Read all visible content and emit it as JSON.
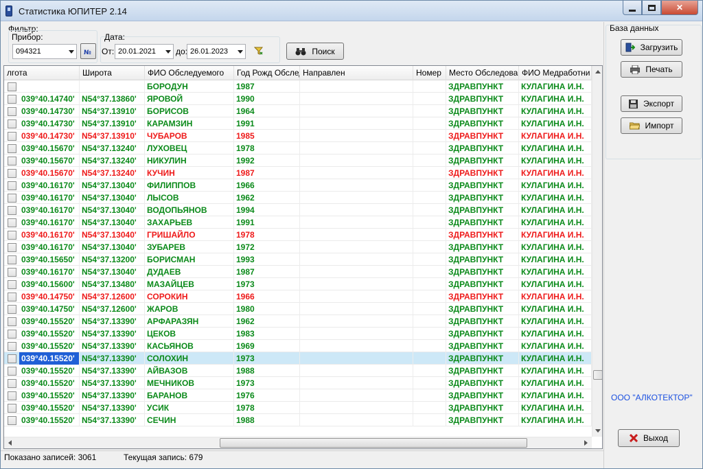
{
  "window": {
    "title": "Статистика ЮПИТЕР 2.14"
  },
  "filter": {
    "label": "Фильтр:",
    "device_label": "Прибор:",
    "device_value": "094321",
    "date_label": "Дата:",
    "from_label": "От:",
    "from_value": "20.01.2021",
    "to_label": "до:",
    "to_value": "26.01.2023",
    "search_label": "Поиск"
  },
  "right_panel": {
    "group_label": "База данных",
    "load_label": "Загрузить",
    "print_label": "Печать",
    "export_label": "Экспорт",
    "import_label": "Импорт",
    "company": "ООО \"АЛКОТЕКТОР\"",
    "exit_label": "Выход"
  },
  "grid": {
    "columns": [
      "лгота",
      "Широта",
      "ФИО Обследуемого",
      "Год Рожд Обслед",
      "Направлен",
      "Номер",
      "Место Обследова",
      "ФИО Медработни"
    ],
    "rows": [
      {
        "lon": "",
        "lat": "",
        "name": "БОРОДУН",
        "year": "1987",
        "place": "ЗДРАВПУНКТ",
        "medic": "КУЛАГИНА И.Н.",
        "color": "g"
      },
      {
        "lon": "039°40.14740'",
        "lat": "N54°37.13860'",
        "name": "ЯРОВОЙ",
        "year": "1990",
        "place": "ЗДРАВПУНКТ",
        "medic": "КУЛАГИНА И.Н.",
        "color": "g"
      },
      {
        "lon": "039°40.14730'",
        "lat": "N54°37.13910'",
        "name": "БОРИСОВ",
        "year": "1964",
        "place": "ЗДРАВПУНКТ",
        "medic": "КУЛАГИНА И.Н.",
        "color": "g"
      },
      {
        "lon": "039°40.14730'",
        "lat": "N54°37.13910'",
        "name": "КАРАМЗИН",
        "year": "1991",
        "place": "ЗДРАВПУНКТ",
        "medic": "КУЛАГИНА И.Н.",
        "color": "g"
      },
      {
        "lon": "039°40.14730'",
        "lat": "N54°37.13910'",
        "name": "ЧУБАРОВ",
        "year": "1985",
        "place": "ЗДРАВПУНКТ",
        "medic": "КУЛАГИНА И.Н.",
        "color": "r"
      },
      {
        "lon": "039°40.15670'",
        "lat": "N54°37.13240'",
        "name": "ЛУХОВЕЦ",
        "year": "1978",
        "place": "ЗДРАВПУНКТ",
        "medic": "КУЛАГИНА И.Н.",
        "color": "g"
      },
      {
        "lon": "039°40.15670'",
        "lat": "N54°37.13240'",
        "name": "НИКУЛИН",
        "year": "1992",
        "place": "ЗДРАВПУНКТ",
        "medic": "КУЛАГИНА И.Н.",
        "color": "g"
      },
      {
        "lon": "039°40.15670'",
        "lat": "N54°37.13240'",
        "name": "КУЧИН",
        "year": "1987",
        "place": "ЗДРАВПУНКТ",
        "medic": "КУЛАГИНА И.Н.",
        "color": "r"
      },
      {
        "lon": "039°40.16170'",
        "lat": "N54°37.13040'",
        "name": "ФИЛИППОВ",
        "year": "1966",
        "place": "ЗДРАВПУНКТ",
        "medic": "КУЛАГИНА И.Н.",
        "color": "g"
      },
      {
        "lon": "039°40.16170'",
        "lat": "N54°37.13040'",
        "name": "ЛЫСОВ",
        "year": "1962",
        "place": "ЗДРАВПУНКТ",
        "medic": "КУЛАГИНА И.Н.",
        "color": "g"
      },
      {
        "lon": "039°40.16170'",
        "lat": "N54°37.13040'",
        "name": "ВОДОПЬЯНОВ",
        "year": "1994",
        "place": "ЗДРАВПУНКТ",
        "medic": "КУЛАГИНА И.Н.",
        "color": "g"
      },
      {
        "lon": "039°40.16170'",
        "lat": "N54°37.13040'",
        "name": "ЗАХАРЬЕВ",
        "year": "1991",
        "place": "ЗДРАВПУНКТ",
        "medic": "КУЛАГИНА И.Н.",
        "color": "g"
      },
      {
        "lon": "039°40.16170'",
        "lat": "N54°37.13040'",
        "name": "ГРИШАЙЛО",
        "year": "1978",
        "place": "ЗДРАВПУНКТ",
        "medic": "КУЛАГИНА И.Н.",
        "color": "r"
      },
      {
        "lon": "039°40.16170'",
        "lat": "N54°37.13040'",
        "name": "ЗУБАРЕВ",
        "year": "1972",
        "place": "ЗДРАВПУНКТ",
        "medic": "КУЛАГИНА И.Н.",
        "color": "g"
      },
      {
        "lon": "039°40.15650'",
        "lat": "N54°37.13200'",
        "name": "БОРИСМАН",
        "year": "1993",
        "place": "ЗДРАВПУНКТ",
        "medic": "КУЛАГИНА И.Н.",
        "color": "g"
      },
      {
        "lon": "039°40.16170'",
        "lat": "N54°37.13040'",
        "name": "ДУДАЕВ",
        "year": "1987",
        "place": "ЗДРАВПУНКТ",
        "medic": "КУЛАГИНА И.Н.",
        "color": "g"
      },
      {
        "lon": "039°40.15600'",
        "lat": "N54°37.13480'",
        "name": "МАЗАЙЦЕВ",
        "year": "1973",
        "place": "ЗДРАВПУНКТ",
        "medic": "КУЛАГИНА И.Н.",
        "color": "g"
      },
      {
        "lon": "039°40.14750'",
        "lat": "N54°37.12600'",
        "name": "СОРОКИН",
        "year": "1966",
        "place": "ЗДРАВПУНКТ",
        "medic": "КУЛАГИНА И.Н.",
        "color": "r"
      },
      {
        "lon": "039°40.14750'",
        "lat": "N54°37.12600'",
        "name": "ЖАРОВ",
        "year": "1980",
        "place": "ЗДРАВПУНКТ",
        "medic": "КУЛАГИНА И.Н.",
        "color": "g"
      },
      {
        "lon": "039°40.15520'",
        "lat": "N54°37.13390'",
        "name": "АРФАРАЗЯН",
        "year": "1962",
        "place": "ЗДРАВПУНКТ",
        "medic": "КУЛАГИНА И.Н.",
        "color": "g"
      },
      {
        "lon": "039°40.15520'",
        "lat": "N54°37.13390'",
        "name": "ЦЕКОВ",
        "year": "1983",
        "place": "ЗДРАВПУНКТ",
        "medic": "КУЛАГИНА И.Н.",
        "color": "g"
      },
      {
        "lon": "039°40.15520'",
        "lat": "N54°37.13390'",
        "name": "КАСЬЯНОВ",
        "year": "1969",
        "place": "ЗДРАВПУНКТ",
        "medic": "КУЛАГИНА И.Н.",
        "color": "g"
      },
      {
        "lon": "039°40.15520'",
        "lat": "N54°37.13390'",
        "name": "СОЛОХИН",
        "year": "1973",
        "place": "ЗДРАВПУНКТ",
        "medic": "КУЛАГИНА И.Н.",
        "color": "g",
        "selected": true
      },
      {
        "lon": "039°40.15520'",
        "lat": "N54°37.13390'",
        "name": "АЙВАЗОВ",
        "year": "1988",
        "place": "ЗДРАВПУНКТ",
        "medic": "КУЛАГИНА И.Н.",
        "color": "g"
      },
      {
        "lon": "039°40.15520'",
        "lat": "N54°37.13390'",
        "name": "МЕЧНИКОВ",
        "year": "1973",
        "place": "ЗДРАВПУНКТ",
        "medic": "КУЛАГИНА И.Н.",
        "color": "g"
      },
      {
        "lon": "039°40.15520'",
        "lat": "N54°37.13390'",
        "name": "БАРАНОВ",
        "year": "1976",
        "place": "ЗДРАВПУНКТ",
        "medic": "КУЛАГИНА И.Н.",
        "color": "g"
      },
      {
        "lon": "039°40.15520'",
        "lat": "N54°37.13390'",
        "name": "УСИК",
        "year": "1978",
        "place": "ЗДРАВПУНКТ",
        "medic": "КУЛАГИНА И.Н.",
        "color": "g"
      },
      {
        "lon": "039°40.15520'",
        "lat": "N54°37.13390'",
        "name": "СЕЧИН",
        "year": "1988",
        "place": "ЗДРАВПУНКТ",
        "medic": "КУЛАГИНА И.Н.",
        "color": "g"
      }
    ]
  },
  "status": {
    "shown_records": "Показано записей: 3061",
    "current_record": "Текущая запись: 679"
  },
  "colors": {
    "normal_text": "#0b8a1a",
    "alert_text": "#ee1a1a",
    "selected_row": "#cde8f7",
    "focused_cell": "#1f5fd6",
    "company_text": "#1a4fe0"
  },
  "icons": [
    "app-icon",
    "minimize-icon",
    "maximize-icon",
    "close-icon",
    "number-icon",
    "filter-icon",
    "binoculars-icon",
    "load-icon",
    "printer-icon",
    "save-icon",
    "folder-icon",
    "exit-x-icon"
  ]
}
